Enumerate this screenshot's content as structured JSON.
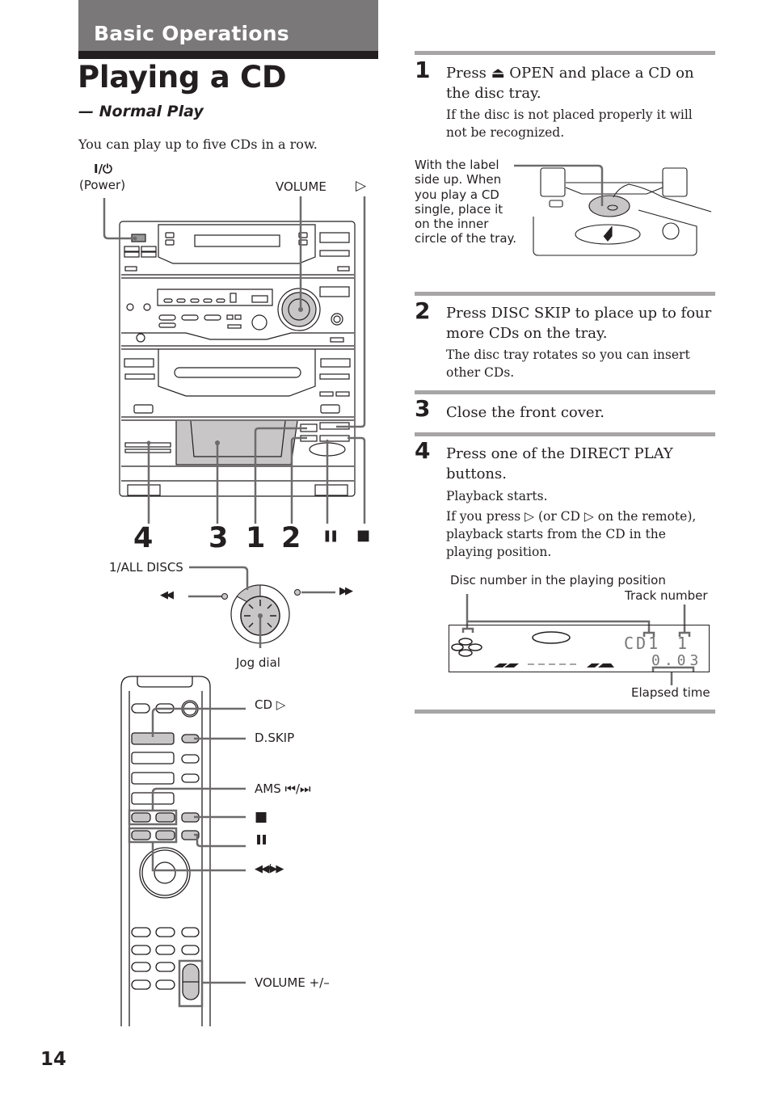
{
  "header": {
    "section": "Basic Operations",
    "title": "Playing a CD",
    "subtitle": "— Normal Play",
    "intro": "You can play up to five CDs in a row."
  },
  "main_unit_callouts": {
    "power_symbol": "I/⏻",
    "power": "(Power)",
    "volume": "VOLUME",
    "play_symbol": "▷",
    "numbers": [
      "4",
      "3",
      "1",
      "2"
    ],
    "pause_symbol": "❚❚",
    "stop_symbol": "■"
  },
  "jog_dial_callouts": {
    "all_discs": "1/ALL DISCS",
    "rewind_symbol": "◀◀",
    "ffwd_symbol": "▶▶",
    "jog_dial": "Jog dial"
  },
  "remote_callouts": {
    "cd_play": "CD ▷",
    "dskip": "D.SKIP",
    "ams": "AMS ⏮/⏭",
    "stop": "■",
    "pause": "❚❚",
    "rew_ff": "◀◀/▶▶",
    "volume": "VOLUME +/–"
  },
  "steps": [
    {
      "number": "1",
      "main": "Press ⏏ OPEN and place a CD on the disc tray.",
      "note": "If the disc is not placed properly it will not be recognized."
    },
    {
      "number": "2",
      "main": "Press DISC SKIP to place up to four more CDs on the tray.",
      "note": "The disc tray rotates so you can insert other CDs."
    },
    {
      "number": "3",
      "main": "Close the front cover.",
      "note": ""
    },
    {
      "number": "4",
      "main": "Press one of the DIRECT PLAY buttons.",
      "note": "Playback starts.",
      "note2": "If you press ▷ (or CD ▷ on the remote), playback starts from the CD in the playing position."
    }
  ],
  "tray_note": "With the label side up. When you play a CD single, place it on the inner circle of the tray.",
  "display": {
    "disc_label": "Disc number in the playing position",
    "track_label": "Track number",
    "elapsed_label": "Elapsed time",
    "cd_readout": "CD1",
    "track_readout": "1",
    "time_readout": "0.03"
  },
  "page_number": "14"
}
